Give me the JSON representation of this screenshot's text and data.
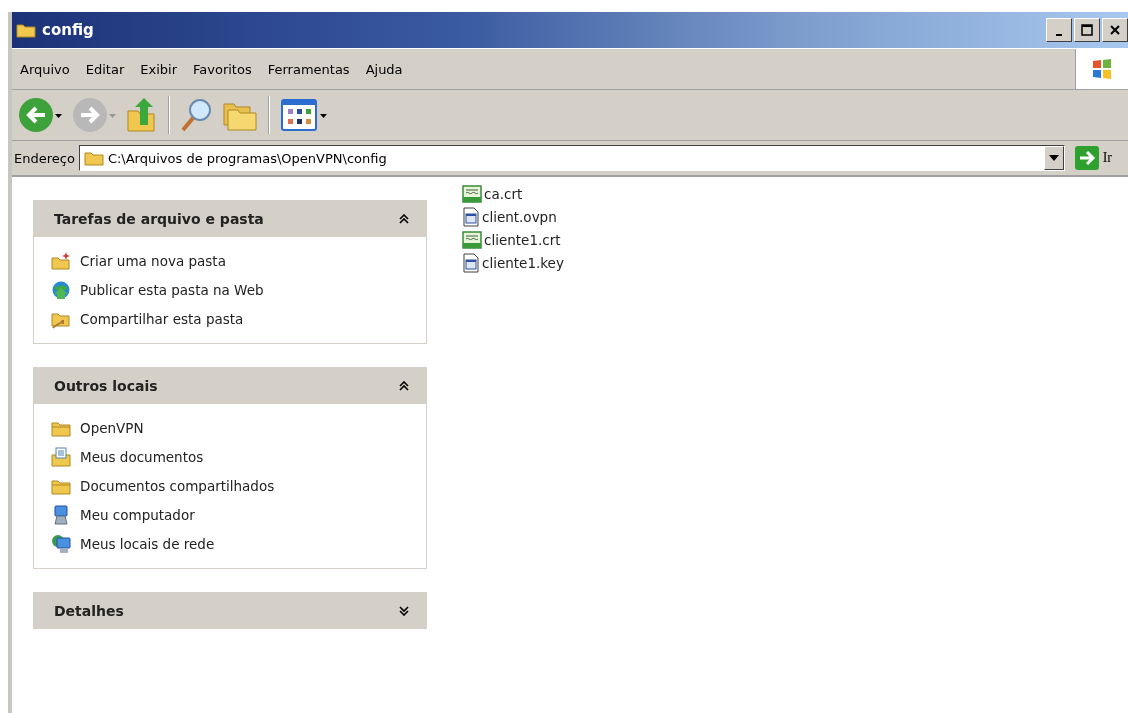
{
  "window": {
    "title": "config"
  },
  "menu": [
    "Arquivo",
    "Editar",
    "Exibir",
    "Favoritos",
    "Ferramentas",
    "Ajuda"
  ],
  "address": {
    "label": "Endereço",
    "value": "C:\\Arquivos de programas\\OpenVPN\\config",
    "go": "Ir"
  },
  "sidebar": [
    {
      "title": "Tarefas de arquivo e pasta",
      "expanded": true,
      "items": [
        "Criar uma nova pasta",
        "Publicar esta pasta na Web",
        "Compartilhar esta pasta"
      ]
    },
    {
      "title": "Outros locais",
      "expanded": true,
      "items": [
        "OpenVPN",
        "Meus documentos",
        "Documentos compartilhados",
        "Meu computador",
        "Meus locais de rede"
      ]
    },
    {
      "title": "Detalhes",
      "expanded": false
    }
  ],
  "files": [
    "ca.crt",
    "client.ovpn",
    "cliente1.crt",
    "cliente1.key"
  ]
}
